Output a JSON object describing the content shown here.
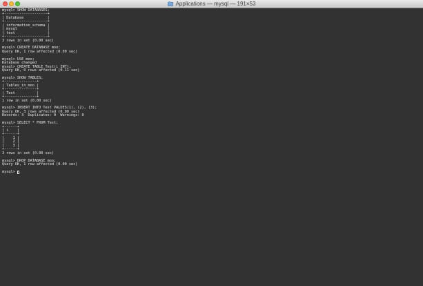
{
  "window": {
    "title": "Applications — mysql — 191×53"
  },
  "terminal": {
    "lines": [
      "mysql> SHOW DATABASES;",
      "+--------------------+",
      "| Database           |",
      "+--------------------+",
      "| information_schema |",
      "| mysql              |",
      "| test               |",
      "+--------------------+",
      "3 rows in set (0.00 sec)",
      "",
      "mysql> CREATE DATABASE moo;",
      "Query OK, 1 row affected (0.00 sec)",
      "",
      "mysql> USE moo;",
      "Database changed",
      "mysql> CREATE TABLE Test(i INT);",
      "Query OK, 0 rows affected (0.11 sec)",
      "",
      "mysql> SHOW TABLES;",
      "+---------------+",
      "| Tables_in_moo |",
      "+---------------+",
      "| Test          |",
      "+---------------+",
      "1 row in set (0.00 sec)",
      "",
      "mysql> INSERT INTO Test VALUES(1), (2), (3);",
      "Query OK, 3 rows affected (0.00 sec)",
      "Records: 3  Duplicates: 0  Warnings: 0",
      "",
      "mysql> SELECT * FROM Test;",
      "+------+",
      "| i    |",
      "+------+",
      "|    1 |",
      "|    2 |",
      "|    3 |",
      "+------+",
      "3 rows in set (0.00 sec)",
      "",
      "mysql> DROP DATABASE moo;",
      "Query OK, 1 row affected (0.00 sec)",
      ""
    ],
    "prompt": "mysql> "
  }
}
